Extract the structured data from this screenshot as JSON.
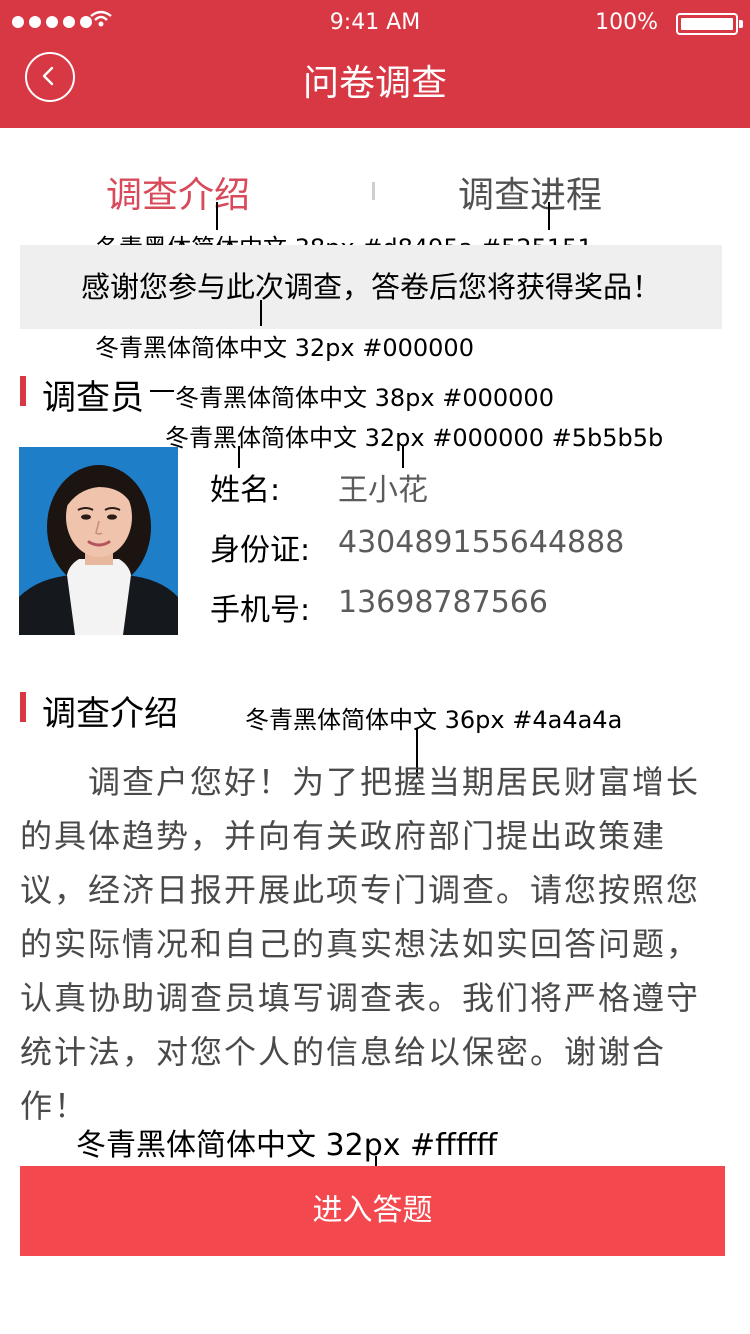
{
  "status_bar": {
    "time": "9:41 AM",
    "battery": "100%",
    "signal_icon": "signal-dots-icon",
    "wifi_icon": "wifi-icon",
    "battery_icon": "battery-icon"
  },
  "header": {
    "title": "问卷调查",
    "back_icon": "back-chevron-icon",
    "bg_color": "#d83744"
  },
  "tabs": [
    {
      "label": "调查介绍",
      "active": true,
      "color": "#d8495a"
    },
    {
      "label": "调查进程",
      "active": false,
      "color": "#525151"
    }
  ],
  "annotations": {
    "tabs_spec": "冬青黑体简体中文 38px #d8495a #525151",
    "notice_spec": "冬青黑体简体中文 32px #000000",
    "section_spec": "冬青黑体简体中文 38px #000000",
    "info_spec": "冬青黑体简体中文 32px #000000 #5b5b5b",
    "body_spec": "冬青黑体简体中文 36px #4a4a4a",
    "button_spec": "冬青黑体简体中文 32px #ffffff"
  },
  "notice": "感谢您参与此次调查，答卷后您将获得奖品！",
  "investigator": {
    "section_title": "调查员",
    "rows": [
      {
        "label": "姓名:",
        "value": "王小花"
      },
      {
        "label": "身份证:",
        "value": "430489155644888"
      },
      {
        "label": "手机号:",
        "value": "13698787566"
      }
    ]
  },
  "intro": {
    "section_title": "调查介绍",
    "text": "　　调查户您好！为了把握当期居民财富增长的具体趋势，并向有关政府部门提出政策建议，经济日报开展此项专门调查。请您按照您的实际情况和自己的真实想法如实回答问题，认真协助调查员填写调查表。我们将严格遵守统计法，对您个人的信息给以保密。谢谢合作！"
  },
  "cta": {
    "label": "进入答题",
    "color": "#f2484e"
  }
}
